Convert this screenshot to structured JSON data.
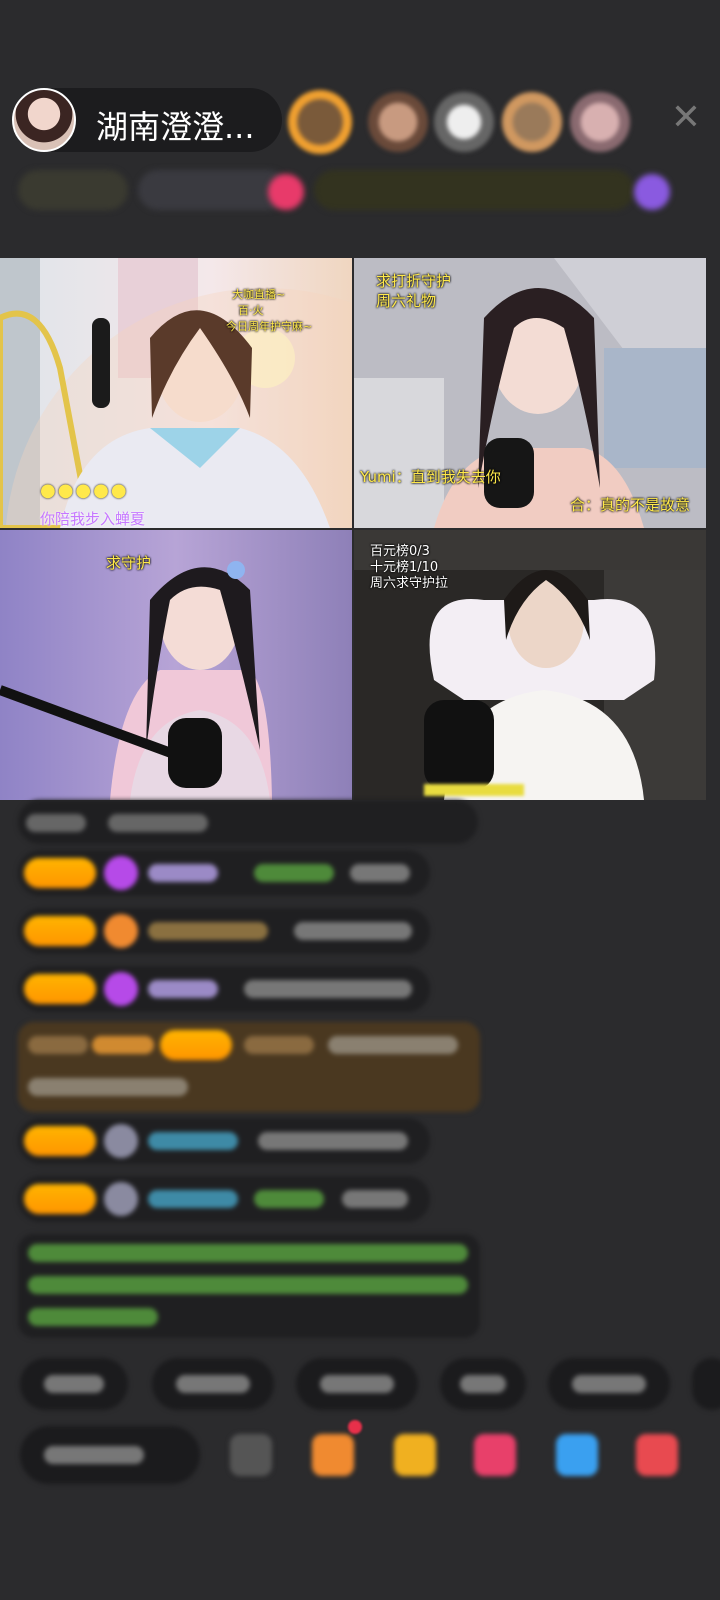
{
  "header": {
    "host_name": "湖南澄澄..."
  },
  "videos": {
    "top_left": {
      "overlay_top": [
        "大咖直播~",
        "百·火",
        "今日周年护守麻~"
      ],
      "overlay_bottom": "你陪我步入蝉夏"
    },
    "top_right": {
      "overlay_top": [
        "求打折守护",
        "周六礼物"
      ],
      "caption_left": "Yumi：直到我失去你",
      "caption_right": "合：真的不是故意"
    },
    "bottom_left": {
      "overlay_top": "求守护"
    },
    "bottom_right": {
      "overlay_top": [
        "百元榜0/3",
        "十元榜1/10",
        "周六求守护拉"
      ]
    }
  },
  "colors": {
    "background": "#2b2b2d",
    "badge_orange": "#ffb400",
    "overlay_yellow": "#ffe94a"
  }
}
